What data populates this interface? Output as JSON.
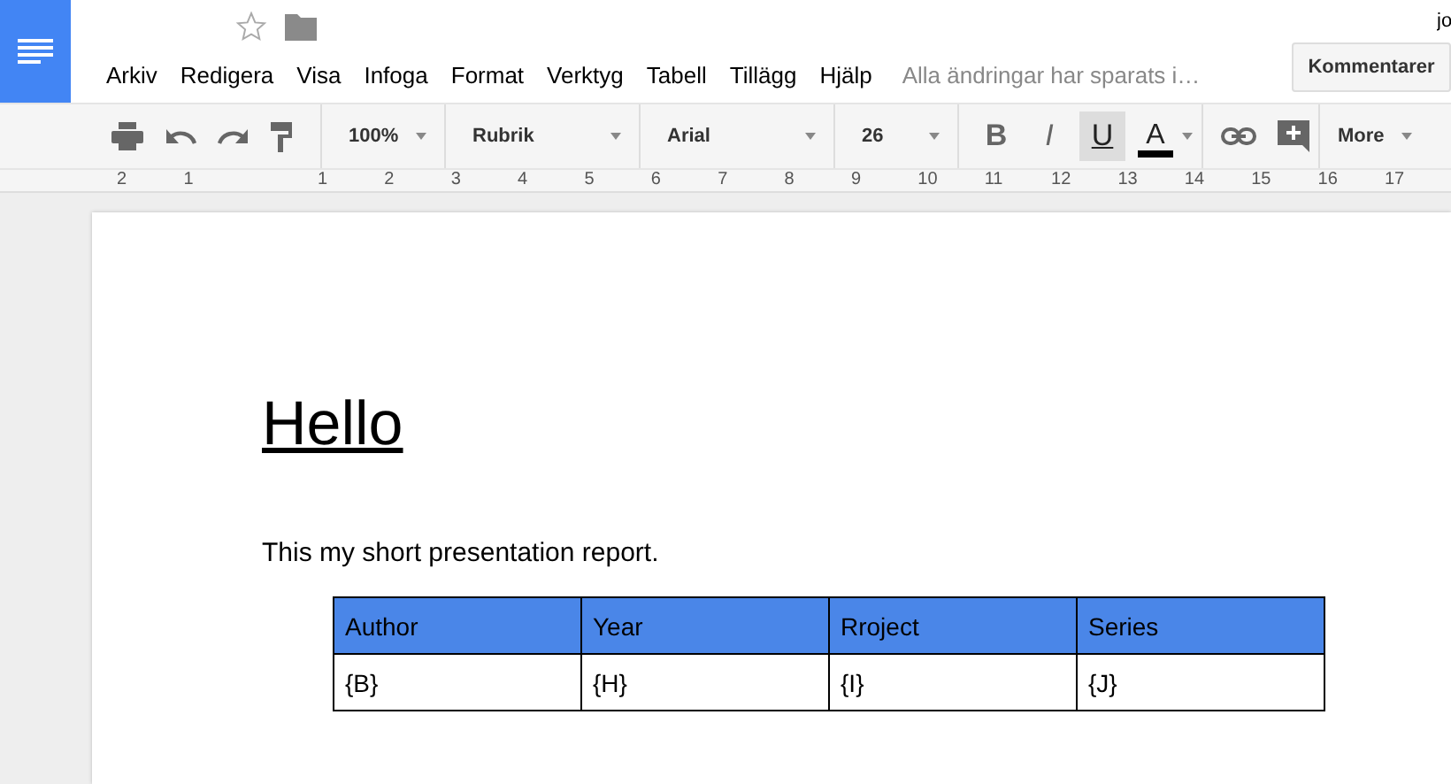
{
  "header": {
    "user": "jo",
    "comment_button": "Kommentarer",
    "save_status": "Alla ändringar har sparats i…"
  },
  "menu": [
    "Arkiv",
    "Redigera",
    "Visa",
    "Infoga",
    "Format",
    "Verktyg",
    "Tabell",
    "Tillägg",
    "Hjälp"
  ],
  "toolbar": {
    "zoom": "100%",
    "style": "Rubrik",
    "font": "Arial",
    "size": "26",
    "more": "More",
    "format_buttons": [
      {
        "kind": "bold",
        "label": "B",
        "selected": false
      },
      {
        "kind": "italic",
        "label": "I",
        "selected": false
      },
      {
        "kind": "underline",
        "label": "U",
        "selected": true
      },
      {
        "kind": "text_color",
        "label": "A",
        "color": "#000000"
      }
    ]
  },
  "ruler": [
    "2",
    "1",
    "1",
    "2",
    "3",
    "4",
    "5",
    "6",
    "7",
    "8",
    "9",
    "10",
    "11",
    "12",
    "13",
    "14",
    "15",
    "16",
    "17"
  ],
  "document": {
    "title": "Hello",
    "paragraph": "This my short presentation report.",
    "table": {
      "columns": [
        "Author",
        "Year",
        "Rroject",
        "Series"
      ],
      "rows": [
        [
          "{B}",
          "{H}",
          "{I}",
          "{J}"
        ]
      ]
    }
  }
}
